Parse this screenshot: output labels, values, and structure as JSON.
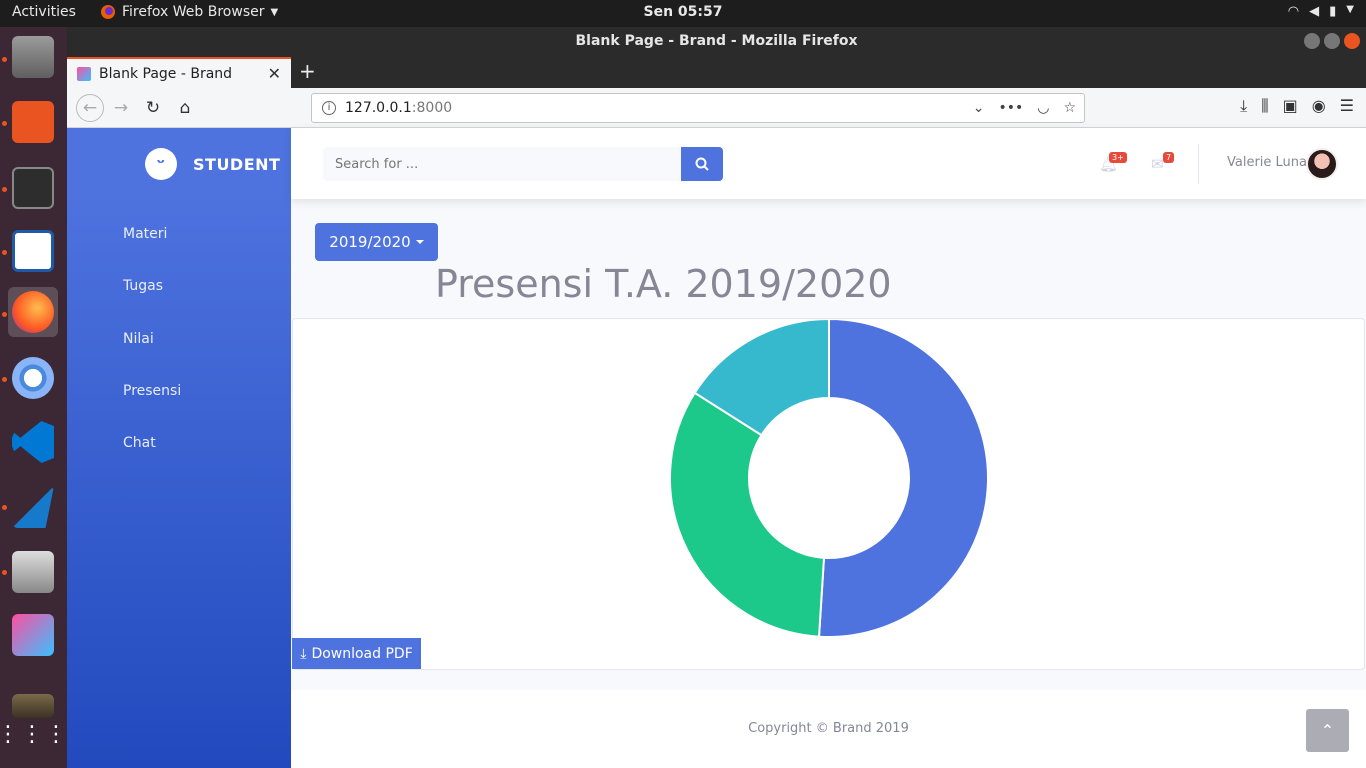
{
  "topbar": {
    "activities": "Activities",
    "app_menu": "Firefox Web Browser",
    "clock": "Sen 05:57"
  },
  "window": {
    "title": "Blank Page - Brand - Mozilla Firefox"
  },
  "tab": {
    "label": "Blank Page - Brand"
  },
  "urlbar": {
    "host": "127.0.0.1",
    "port": ":8000"
  },
  "sidebar": {
    "brand": "STUDENT",
    "items": [
      {
        "label": "Materi"
      },
      {
        "label": "Tugas"
      },
      {
        "label": "Nilai"
      },
      {
        "label": "Presensi"
      },
      {
        "label": "Chat"
      }
    ]
  },
  "topnav": {
    "search_placeholder": "Search for ...",
    "alerts_badge": "3+",
    "messages_badge": "7",
    "user_name": "Valerie Luna"
  },
  "main": {
    "year_button": "2019/2020",
    "heading": "Presensi T.A. 2019/2020",
    "download_label": "Download PDF"
  },
  "chart_data": {
    "type": "pie",
    "donut": true,
    "values": [
      51,
      33,
      16
    ],
    "colors": [
      "#4e73df",
      "#1cc88a",
      "#36b9cc"
    ],
    "legend": false
  },
  "footer": {
    "copyright": "Copyright © Brand 2019"
  },
  "colors": {
    "primary": "#4e73df",
    "success": "#1cc88a",
    "info": "#36b9cc",
    "danger": "#e74a3b"
  }
}
